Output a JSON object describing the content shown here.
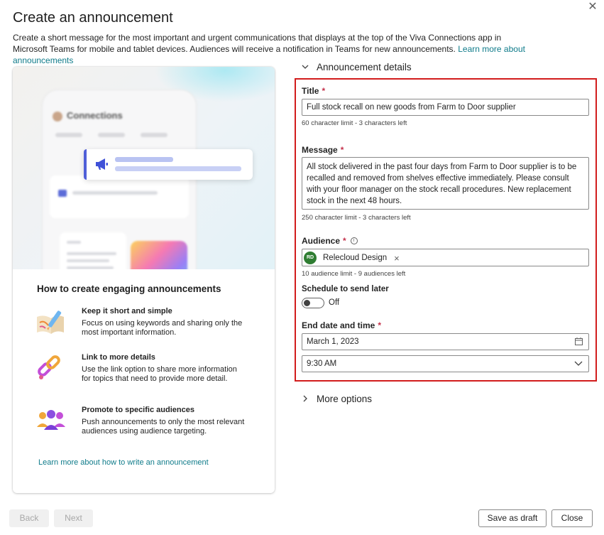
{
  "dialog": {
    "title": "Create an announcement",
    "intro": "Create a short message for the most important and urgent communications that displays at the top of the Viva Connections app in Microsoft Teams for mobile and tablet devices. Audiences will receive a notification in Teams for new announcements. ",
    "intro_link": "Learn more about announcements",
    "close_glyph": "✕"
  },
  "preview": {
    "app_name": "Connections"
  },
  "guide": {
    "heading": "How to create engaging announcements",
    "tips": [
      {
        "title": "Keep it short and simple",
        "body": "Focus on using keywords and sharing only the most important information.",
        "icon": "pencil-paper-icon"
      },
      {
        "title": "Link to more details",
        "body": "Use the link option to share more information for topics that need to provide more detail.",
        "icon": "chain-link-icon"
      },
      {
        "title": "Promote to specific audiences",
        "body": "Push announcements to only the most relevant audiences using audience targeting.",
        "icon": "people-group-icon"
      }
    ],
    "learn_link": "Learn more about how to write an announcement"
  },
  "details": {
    "section_label": "Announcement details",
    "title_label": "Title",
    "title_value": "Full stock recall on new goods from Farm to Door supplier",
    "title_hint": "60 character limit - 3 characters left",
    "message_label": "Message",
    "message_value": "All stock delivered in the past four days from Farm to Door supplier is to be recalled and removed from shelves effective immediately. Please consult with your floor manager on the stock recall procedures. New replacement stock in the next 48 hours.",
    "message_hint": "250 character limit - 3 characters left",
    "audience_label": "Audience",
    "audience_chip_initials": "RD",
    "audience_chip_name": "Relecloud Design",
    "audience_hint": "10 audience limit - 9 audiences left",
    "schedule_label": "Schedule to send later",
    "schedule_state": "Off",
    "end_label": "End date and time",
    "end_date": "March 1, 2023",
    "end_time": "9:30 AM",
    "required_mark": "*"
  },
  "more_options": {
    "label": "More options"
  },
  "footer": {
    "back_label": "Back",
    "next_label": "Next",
    "save_label": "Save as draft",
    "close_label": "Close"
  },
  "colors": {
    "accent_link": "#0f7b8a",
    "highlight_border": "#d21c1c",
    "required": "#c4314b",
    "chip_avatar": "#2f7d32"
  }
}
